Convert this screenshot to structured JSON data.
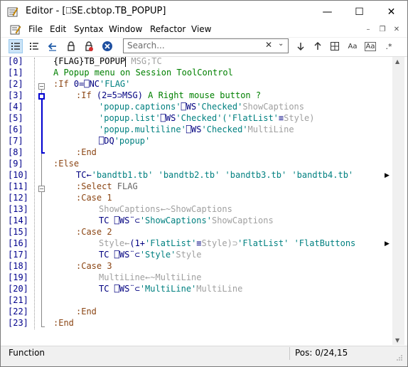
{
  "window": {
    "title": "Editor - [⎕SE.cbtop.TB_POPUP]",
    "minimize": "—",
    "maximize": "☐",
    "close": "✕"
  },
  "menu": {
    "items": [
      "File",
      "Edit",
      "Syntax",
      "Window",
      "Refactor",
      "View"
    ],
    "mdi_minimize": "–",
    "mdi_restore": "❐",
    "mdi_close": "✕"
  },
  "toolbar": {
    "search_placeholder": "Search...",
    "buttons": [
      "list-icon",
      "list-alt-icon",
      "back-arrow-icon",
      "lock-icon",
      "lock-red-icon",
      "close-circle-icon",
      "clear-icon",
      "down-arrow-icon",
      "up-arrow-icon",
      "highlight-icon",
      "select-box-icon",
      "match-case-icon",
      "whole-word-icon",
      "regex-icon"
    ],
    "match_case": "Aa",
    "whole_word": "Aa",
    "regex": ".*"
  },
  "gutter": {
    "line_labels": [
      "[0]",
      "[1]",
      "[2]",
      "[3]",
      "[4]",
      "[5]",
      "[6]",
      "[7]",
      "[8]",
      "[9]",
      "[10]",
      "[11]",
      "[12]",
      "[13]",
      "[14]",
      "[15]",
      "[16]",
      "[17]",
      "[18]",
      "[19]",
      "[20]",
      "[21]",
      "[22]",
      "[23]"
    ]
  },
  "code": {
    "l0": [
      "{FLAG}TB_POPUP",
      " MSG;TC"
    ],
    "l1": "A Popup menu on Session ToolControl",
    "l2": [
      ":If ",
      "0=⎕NC",
      "'FLAG'"
    ],
    "l3": [
      ":If ",
      "(2=5⊃MSG)",
      " A Right mouse button ?"
    ],
    "l4": [
      "'popup.captions'",
      "⎕WS",
      "'Checked'",
      "ShowCaptions"
    ],
    "l5": [
      "'popup.list'",
      "⎕WS",
      "'Checked'",
      "('FlatList'",
      "≡",
      "Style)"
    ],
    "l6": [
      "'popup.multiline'",
      "⎕WS",
      "'Checked'",
      "MultiLine"
    ],
    "l7": [
      "⎕DQ",
      "'popup'"
    ],
    "l8": ":End",
    "l9": ":Else",
    "l10": [
      "TC←",
      "'bandtb1.tb' 'bandtb2.tb' 'bandtb3.tb' 'bandtb4.tb'"
    ],
    "l11": [
      ":Select ",
      "FLAG"
    ],
    "l12": [
      ":Case ",
      "1"
    ],
    "l13": "ShowCaptions←~ShowCaptions",
    "l14": [
      "TC ",
      "⎕WS¨⊂",
      "'ShowCaptions'",
      "ShowCaptions"
    ],
    "l15": [
      ":Case ",
      "2"
    ],
    "l16": [
      "Style←",
      "(1+",
      "'FlatList'",
      "≡",
      "Style)⊃",
      "'FlatList' 'FlatButtons"
    ],
    "l17": [
      "TC ",
      "⎕WS¨⊂",
      "'Style'",
      "Style"
    ],
    "l18": [
      ":Case ",
      "3"
    ],
    "l19": "MultiLine←~MultiLine",
    "l20": [
      "TC ",
      "⎕WS¨⊂",
      "'MultiLine'",
      "MultiLine"
    ],
    "l22": ":End",
    "l23": ":End"
  },
  "status": {
    "left": "Function",
    "right": "Pos: 0/24,15"
  },
  "colors": {
    "keyword": "#8b4513",
    "string": "#008080",
    "comment": "#008000",
    "dimmed": "#a0a0a0",
    "line_number": "#00008b",
    "fold_marker": "#0000d0"
  }
}
